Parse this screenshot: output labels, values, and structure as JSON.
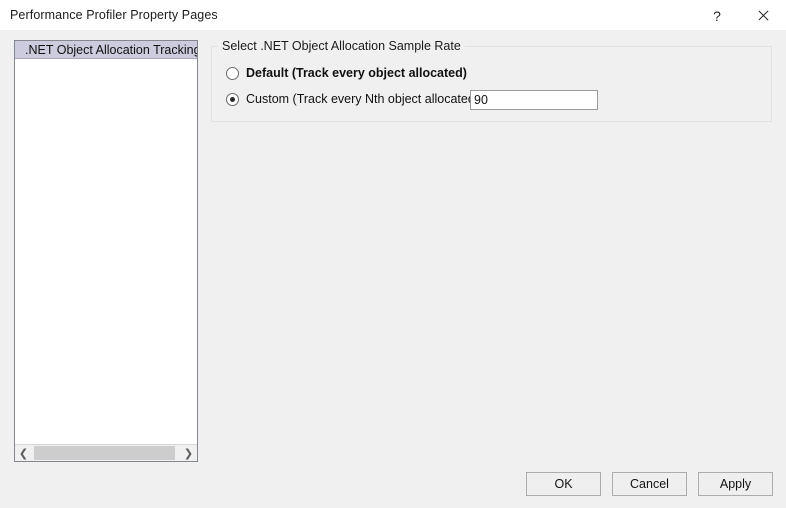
{
  "window": {
    "title": "Performance Profiler Property Pages",
    "help_icon": "?",
    "help_label": "Help",
    "close_label": "Close"
  },
  "tree": {
    "items": [
      {
        "label": ".NET Object Allocation Tracking",
        "selected": true
      }
    ],
    "scrollbar": {
      "left_arrow": "❮",
      "right_arrow": "❯"
    }
  },
  "groupbox": {
    "legend": "Select .NET Object Allocation Sample Rate",
    "options": [
      {
        "id": "default",
        "label": "Default (Track every object allocated)",
        "checked": false,
        "bold": true
      },
      {
        "id": "custom",
        "label": "Custom (Track every Nth object allocated):",
        "checked": true,
        "bold": false
      }
    ],
    "sample_rate": {
      "value": "90",
      "placeholder": ""
    }
  },
  "buttons": {
    "ok": "OK",
    "cancel": "Cancel",
    "apply": "Apply"
  },
  "colors": {
    "dialog_background": "#f0f0f0",
    "titlebar_background": "#ffffff",
    "selection_highlight": "#cdccdf",
    "panel_border": "#828790",
    "groupbox_border": "#dfe3e8",
    "button_face": "#efefef",
    "button_border": "#adadad",
    "scrollbar_thumb": "#cdcdcd",
    "text": "#111111"
  }
}
